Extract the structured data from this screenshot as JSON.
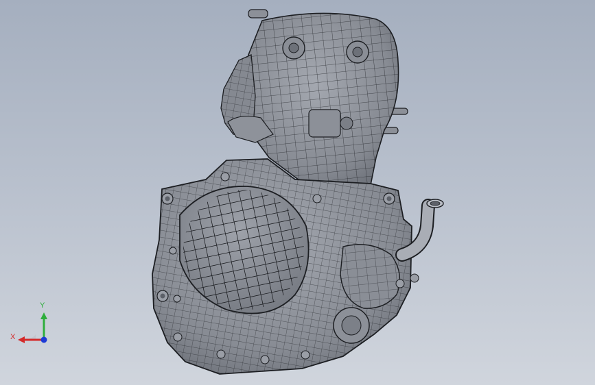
{
  "viewport": {
    "background_top": "#a5afbf",
    "background_bottom": "#d0d5dd"
  },
  "model": {
    "kind": "engine-assembly-3d-model",
    "display_style": "shaded with mesh edges",
    "surface_color": "#888c94",
    "edge_color": "#1c1e22"
  },
  "triad": {
    "y_label": "Y",
    "x_label": "X",
    "y_color": "#2eae3c",
    "x_color": "#d42a2a",
    "z_color": "#1d3ad6"
  }
}
